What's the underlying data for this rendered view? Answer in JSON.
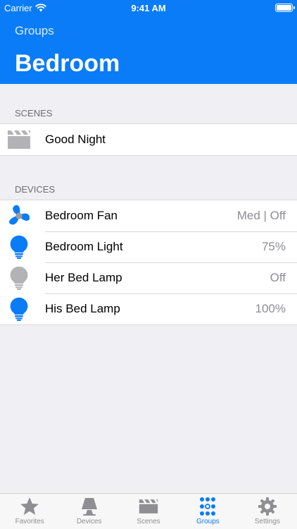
{
  "status": {
    "carrier": "Carrier",
    "time": "9:41 AM"
  },
  "nav": {
    "back_label": "Groups",
    "title": "Bedroom"
  },
  "scenes": {
    "header": "SCENES",
    "items": [
      {
        "label": "Good Night",
        "icon": "clapperboard-icon"
      }
    ]
  },
  "devices": {
    "header": "DEVICES",
    "items": [
      {
        "label": "Bedroom Fan",
        "value": "Med | Off",
        "icon": "fan-icon"
      },
      {
        "label": "Bedroom Light",
        "value": "75%",
        "icon": "bulb-on-icon"
      },
      {
        "label": "Her Bed Lamp",
        "value": "Off",
        "icon": "bulb-off-icon"
      },
      {
        "label": "His Bed Lamp",
        "value": "100%",
        "icon": "bulb-on-icon"
      }
    ]
  },
  "tabs": [
    {
      "label": "Favorites",
      "icon": "star-icon"
    },
    {
      "label": "Devices",
      "icon": "lamp-icon"
    },
    {
      "label": "Scenes",
      "icon": "clapperboard-icon"
    },
    {
      "label": "Groups",
      "icon": "groups-icon",
      "active": true
    },
    {
      "label": "Settings",
      "icon": "gear-icon"
    }
  ],
  "colors": {
    "accent": "#0a7cf7",
    "inactive": "#8e8e93",
    "icon_gray": "#b3b3b6"
  }
}
